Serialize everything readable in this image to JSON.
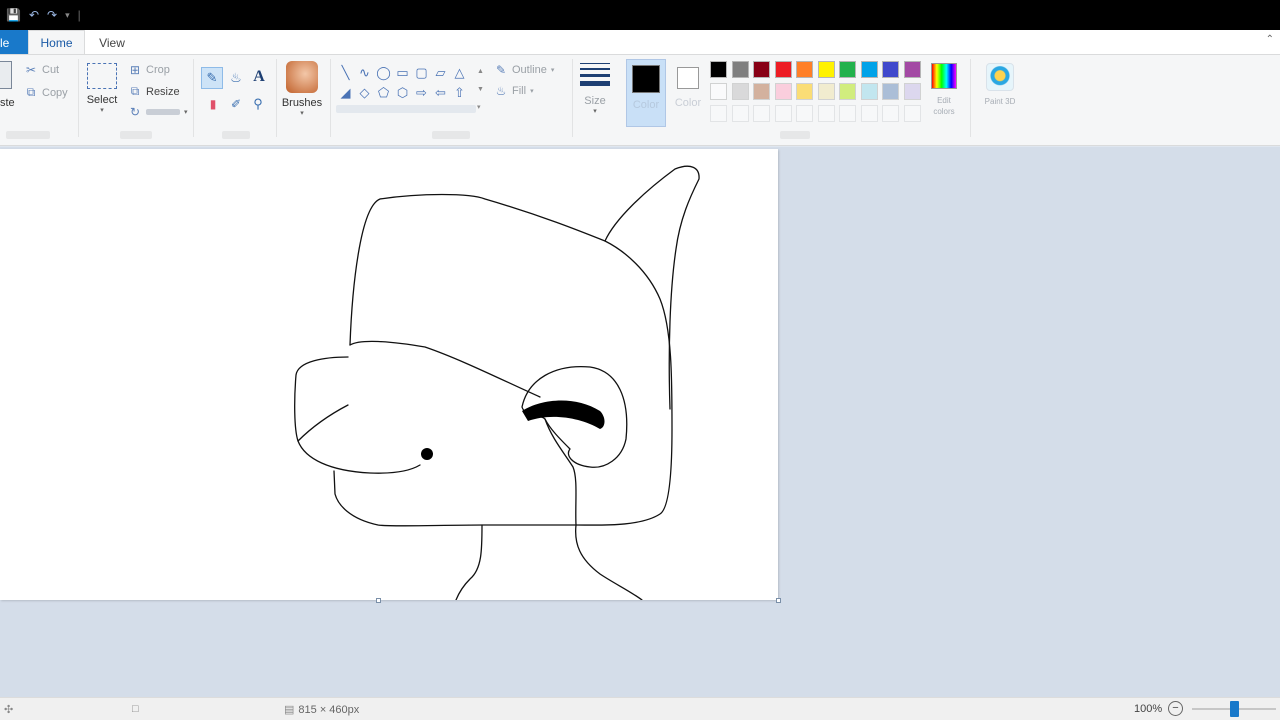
{
  "quick_access": {
    "save_icon": "save-icon",
    "undo_icon": "undo-icon",
    "redo_icon": "redo-icon",
    "customize_icon": "chevron-down-icon"
  },
  "tabs": {
    "file": "le",
    "home": "Home",
    "view": "View"
  },
  "clipboard": {
    "paste": "ste",
    "cut": "Cut",
    "copy": "Copy"
  },
  "image": {
    "select": "Select",
    "crop": "Crop",
    "resize": "Resize"
  },
  "tools": {
    "pencil_icon": "pencil-icon",
    "fill_icon": "fill-bucket-icon",
    "text_icon": "text-icon",
    "eraser_icon": "eraser-icon",
    "picker_icon": "color-picker-icon",
    "magnifier_icon": "magnifier-icon"
  },
  "brushes": {
    "label": "Brushes"
  },
  "shapes": {
    "outline": "Outline",
    "fill": "Fill"
  },
  "size": {
    "label": "Size"
  },
  "colors": {
    "color1_label": "Color",
    "color2_label": "Color",
    "color1_value": "#000000",
    "color2_value": "#ffffff",
    "edit_label": "Edit colors",
    "edit_paint3d_label": "Paint 3D",
    "palette_row1": [
      "#000000",
      "#7f7f7f",
      "#880015",
      "#ed1c24",
      "#ff7f27",
      "#fff200",
      "#22b14c",
      "#00a2e8",
      "#3f48cc",
      "#a349a4"
    ],
    "palette_row2": [
      "#ffffff",
      "#c3c3c3",
      "#b97a57",
      "#ffaec9",
      "#ffc90e",
      "#efe4b0",
      "#b5e61d",
      "#99d9ea",
      "#7092be",
      "#c8bfe7"
    ]
  },
  "status": {
    "cursor_pos": "",
    "selection_size": "",
    "canvas_size": "815 × 460px",
    "zoom": "100%"
  }
}
